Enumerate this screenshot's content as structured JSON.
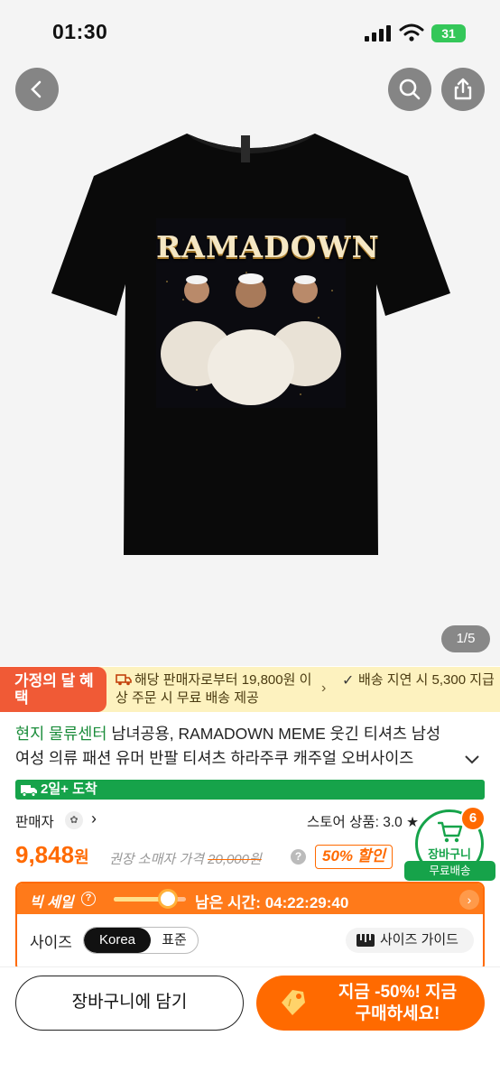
{
  "status_bar": {
    "time": "01:30",
    "battery": "31"
  },
  "hero": {
    "print_title": "RAMADOWN",
    "page_indicator": "1/5"
  },
  "promo": {
    "badge": "가정의 달 혜택",
    "shipping_text": "해당 판매자로부터 19,800원 이상 주문 시 무료 배송 제공",
    "delay_text": "배송 지연 시 5,300 지급"
  },
  "product": {
    "brand": "현지 물류센터",
    "title_line_1": "남녀공용, RAMADOWN MEME 웃긴 티셔츠 남성",
    "title_line_2": "여성 의류 패션 유머 반팔 티셔츠 하라주쿠 캐주얼 오버사이즈"
  },
  "delivery": {
    "label": "2일+ 도착"
  },
  "seller": {
    "label": "판매자",
    "store_rating": "스토어 상품: 3.0 ★"
  },
  "price": {
    "value": "9,848",
    "unit": "원",
    "retail_label": "권장 소매자 가격",
    "retail_price": "20,000원",
    "discount": "50% 할인"
  },
  "cart_fab": {
    "label": "장바구니",
    "count": "6",
    "free_shipping": "무료배송"
  },
  "flash_sale": {
    "label": "빅 세일",
    "progress": 0.75,
    "timer_label": "남은 시간:",
    "timer": "04:22:29:40"
  },
  "size": {
    "label": "사이즈",
    "options": [
      "Korea",
      "표준"
    ],
    "guide": "사이즈 가이드"
  },
  "actions": {
    "add_to_cart": "장바구니에 담기",
    "buy_now_line_1": "지금 -50%! 지금",
    "buy_now_line_2": "구매하세요!"
  },
  "colors": {
    "accent": "#ff6a00",
    "green": "#16a34a",
    "promo_bg": "#fdf2bf"
  }
}
